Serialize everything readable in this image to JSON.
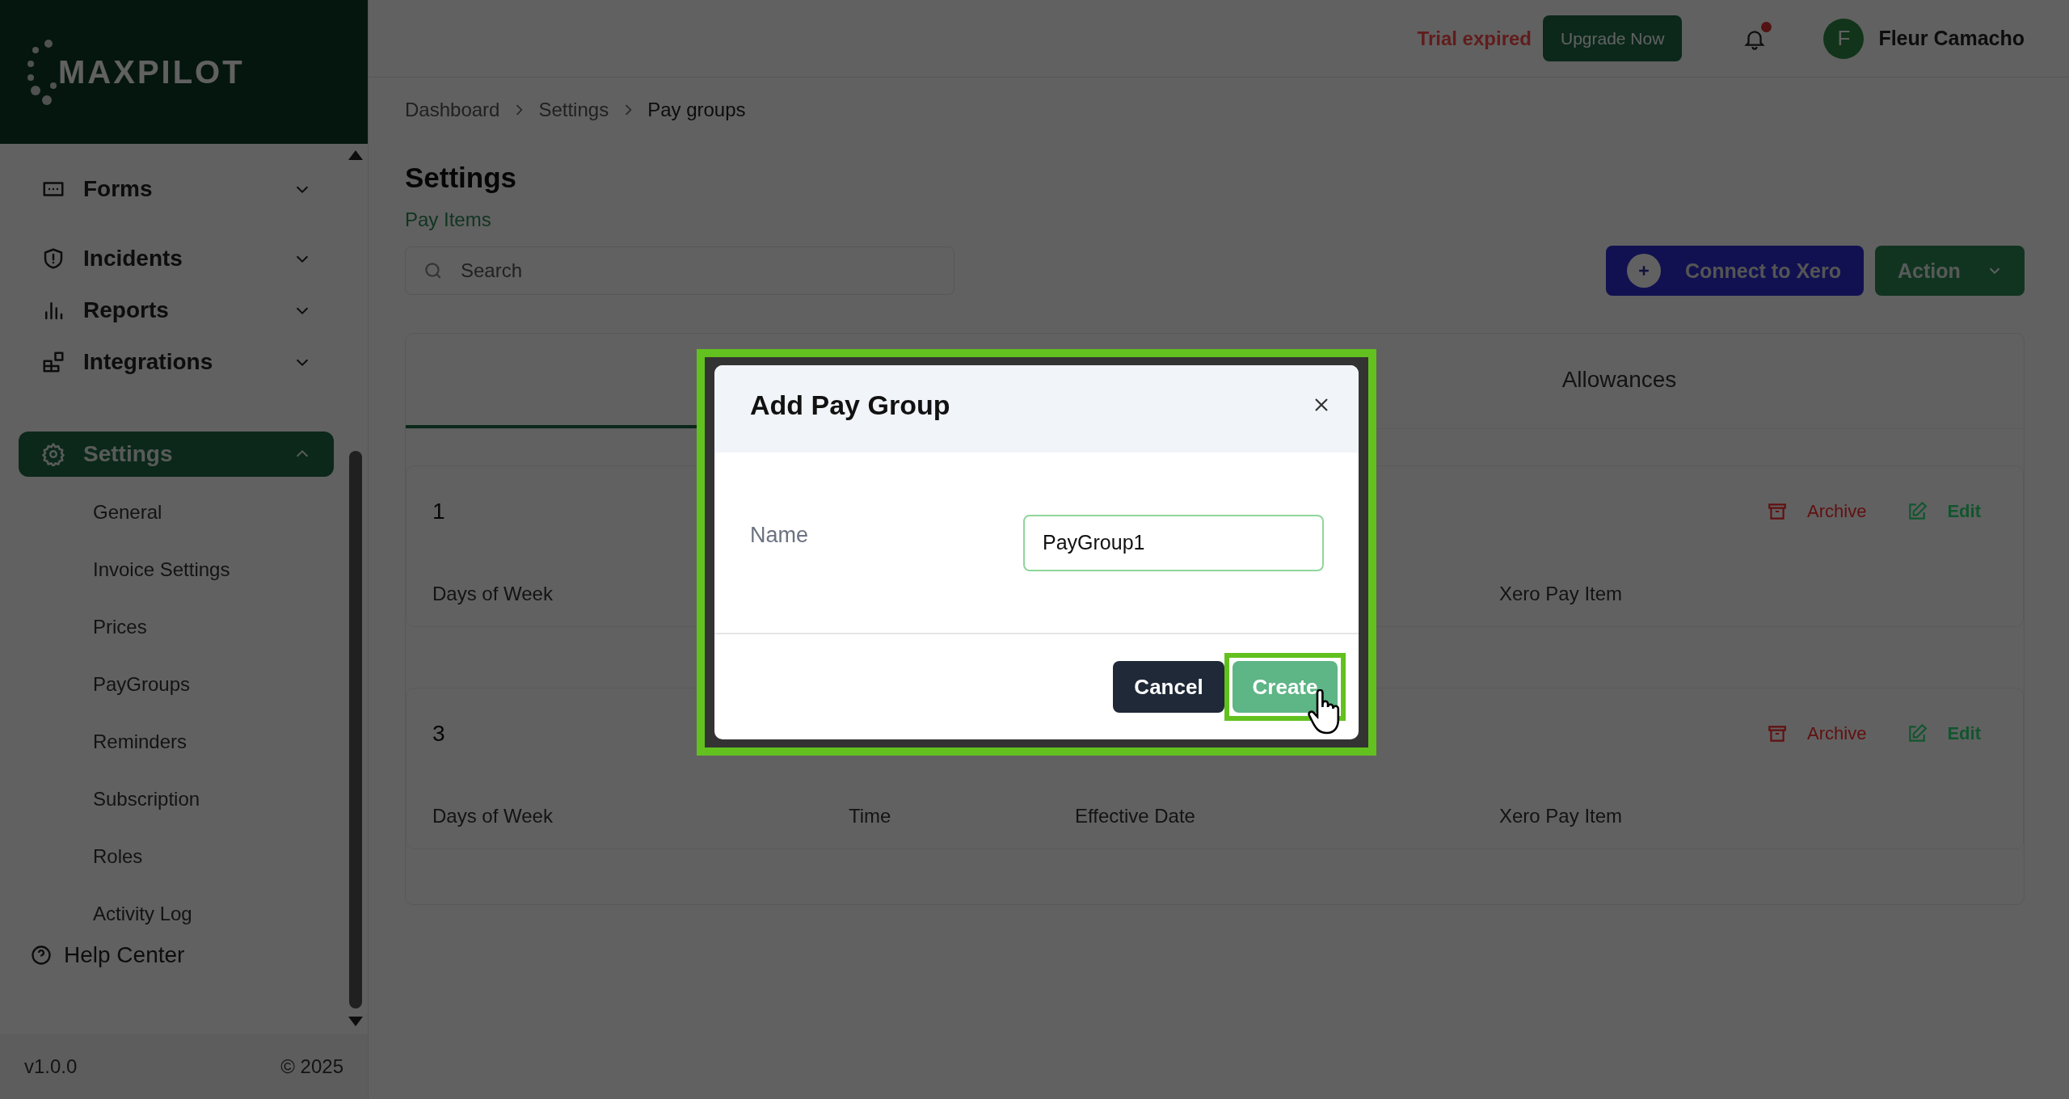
{
  "sidebar": {
    "logo": "MAXPILOT",
    "items": [
      {
        "label": "Forms",
        "selected": false,
        "expanded": false
      },
      {
        "label": "Incidents",
        "selected": false,
        "expanded": false
      },
      {
        "label": "Reports",
        "selected": false,
        "expanded": false
      },
      {
        "label": "Integrations",
        "selected": false,
        "expanded": false
      },
      {
        "label": "Settings",
        "selected": true,
        "expanded": true,
        "children": [
          "General",
          "Invoice Settings",
          "Prices",
          "PayGroups",
          "Reminders",
          "Subscription",
          "Roles",
          "Activity Log"
        ]
      }
    ],
    "help": "Help Center",
    "version": "v1.0.0",
    "copyright": "© 2025"
  },
  "header": {
    "trial": "Trial expired",
    "upgrade": "Upgrade Now",
    "notification_dot": true,
    "user": {
      "initial": "F",
      "name": "Fleur Camacho"
    }
  },
  "breadcrumb": [
    "Dashboard",
    "Settings",
    "Pay groups"
  ],
  "page": {
    "title": "Settings",
    "subtitle": "Pay Items",
    "search": {
      "placeholder": "Search"
    },
    "connect_button": "Connect to Xero",
    "action_button": "Action"
  },
  "tabs": [
    {
      "selected": true
    },
    {
      "label": "Allowances",
      "selected": false
    }
  ],
  "pay_groups": [
    {
      "name": "1",
      "archive": "Archive",
      "edit": "Edit",
      "columns": [
        "Days of Week",
        "Xero Pay Item"
      ]
    },
    {
      "name": "3",
      "archive": "Archive",
      "edit": "Edit",
      "columns": [
        "Days of Week",
        "Time",
        "Effective Date",
        "Xero Pay Item"
      ]
    }
  ],
  "dialog": {
    "title": "Add Pay Group",
    "field_label": "Name",
    "value": "PayGroup1",
    "cancel": "Cancel",
    "create": "Create",
    "create_highlighted": true
  }
}
